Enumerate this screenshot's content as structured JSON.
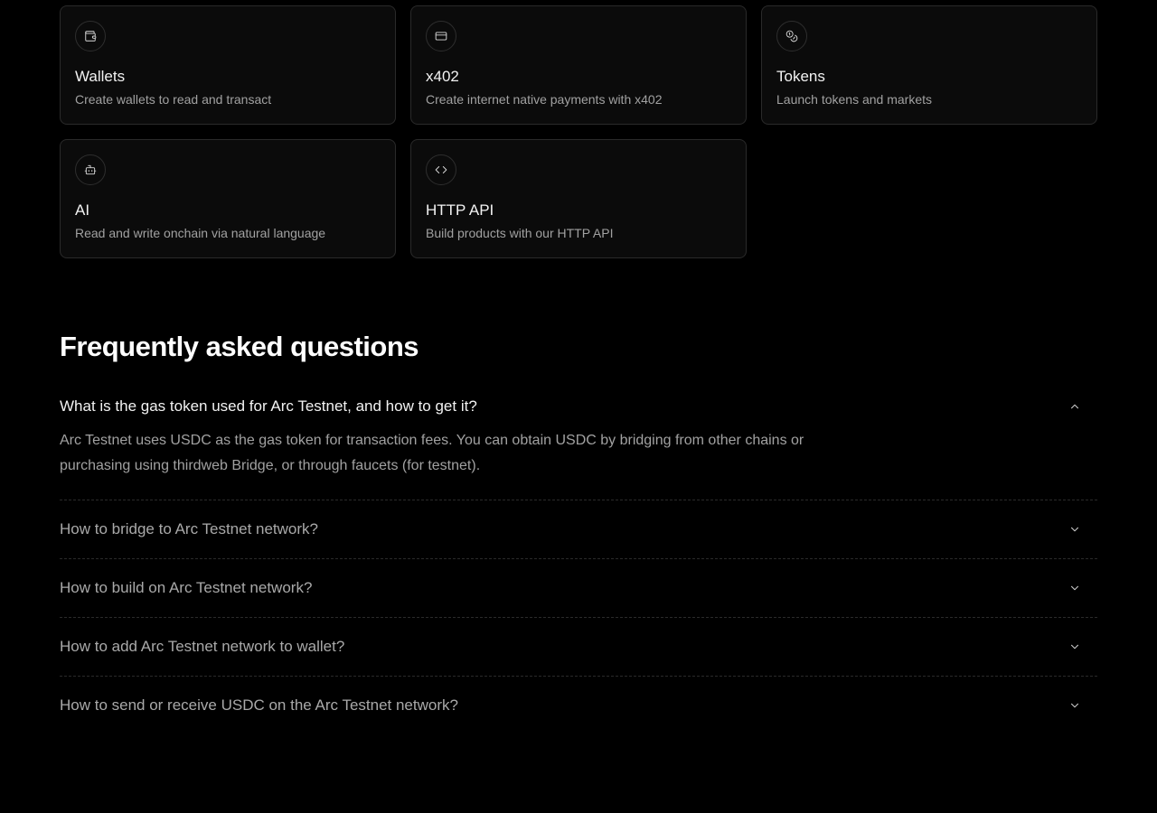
{
  "products": [
    {
      "title": "Wallets",
      "description": "Create wallets to read and transact",
      "icon": "wallet-icon"
    },
    {
      "title": "x402",
      "description": "Create internet native payments with x402",
      "icon": "credit-card-icon"
    },
    {
      "title": "Tokens",
      "description": "Launch tokens and markets",
      "icon": "coins-icon"
    },
    {
      "title": "AI",
      "description": "Read and write onchain via natural language",
      "icon": "bot-icon"
    },
    {
      "title": "HTTP API",
      "description": "Build products with our HTTP API",
      "icon": "code-icon"
    }
  ],
  "faq": {
    "heading": "Frequently asked questions",
    "items": [
      {
        "question": "What is the gas token used for Arc Testnet, and how to get it?",
        "answer": "Arc Testnet uses USDC as the gas token for transaction fees. You can obtain USDC by bridging from other chains or purchasing using thirdweb Bridge, or through faucets (for testnet).",
        "expanded": true
      },
      {
        "question": "How to bridge to Arc Testnet network?",
        "expanded": false
      },
      {
        "question": "How to build on Arc Testnet network?",
        "expanded": false
      },
      {
        "question": "How to add Arc Testnet network to wallet?",
        "expanded": false
      },
      {
        "question": "How to send or receive USDC on the Arc Testnet network?",
        "expanded": false
      }
    ]
  }
}
